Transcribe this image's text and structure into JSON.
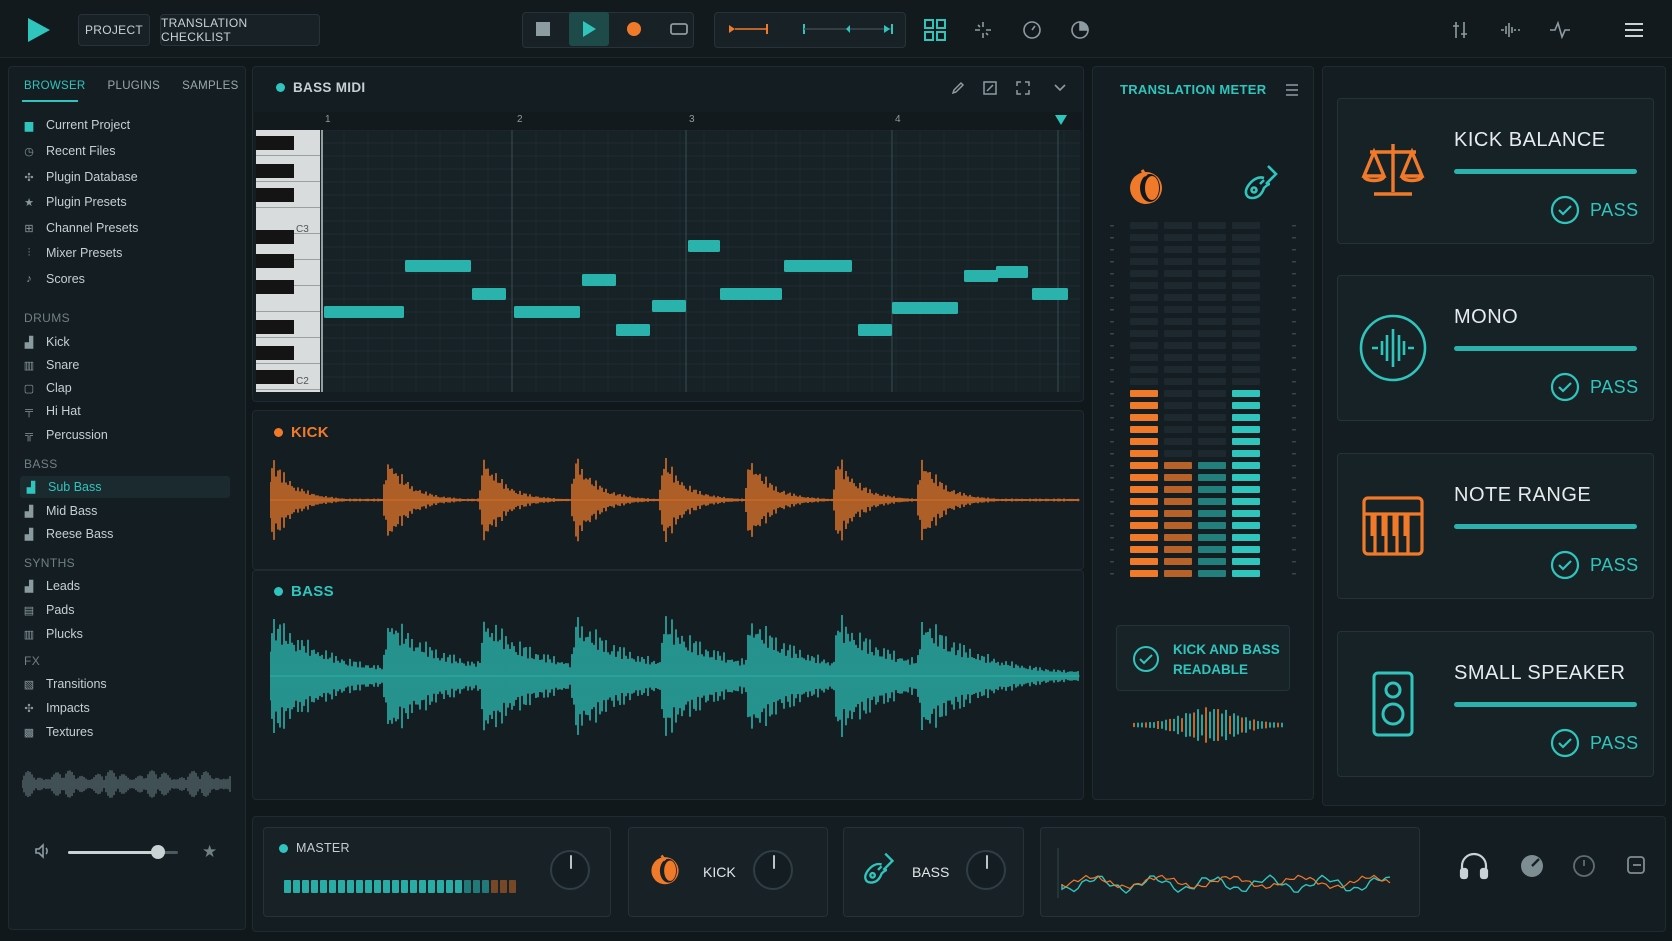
{
  "toolbar": {
    "project_label": "PROJECT",
    "checklist_label": "TRANSLATION CHECKLIST",
    "icons": [
      "play-logo-icon",
      "stop-icon",
      "play-icon",
      "record-icon",
      "loop-icon",
      "marker-icon",
      "timeline-icon",
      "grid-icon",
      "snap-icon",
      "metronome-icon",
      "tempo-icon",
      "tune-icon",
      "waveform-icon",
      "pulse-icon",
      "menu-icon"
    ]
  },
  "browser": {
    "tabs": [
      "BROWSER",
      "PLUGINS",
      "SAMPLES"
    ],
    "active_tab": "BROWSER",
    "items": [
      "Current Project",
      "Recent Files",
      "Plugin Database",
      "Plugin Presets",
      "Channel Presets",
      "Mixer Presets",
      "Scores"
    ],
    "drums_heading": "DRUMS",
    "drums": [
      "Kick",
      "Snare",
      "Clap",
      "Hi Hat",
      "Percussion"
    ],
    "bass_heading": "BASS",
    "bass": [
      "Sub Bass",
      "Mid Bass",
      "Reese Bass"
    ],
    "selected": "Sub Bass",
    "synths_heading": "SYNTHS",
    "synths": [
      "Leads",
      "Pads",
      "Plucks"
    ],
    "fx_heading": "FX",
    "fx": [
      "Transitions",
      "Impacts",
      "Textures"
    ],
    "volume": 0.82
  },
  "piano_roll": {
    "title": "BASS MIDI",
    "bars": [
      "1",
      "2",
      "3",
      "4"
    ],
    "keys": [
      "C3",
      "C2"
    ]
  },
  "tracks": {
    "kick_label": "KICK",
    "bass_label": "BASS"
  },
  "meter": {
    "title": "TRANSLATION METER",
    "status_line1": "KICK AND BASS",
    "status_line2": "READABLE"
  },
  "checks": [
    {
      "title": "KICK BALANCE",
      "status": "PASS",
      "icon": "scale-icon"
    },
    {
      "title": "MONO",
      "status": "PASS",
      "icon": "mono-wave-icon"
    },
    {
      "title": "NOTE RANGE",
      "status": "PASS",
      "icon": "keyboard-icon"
    },
    {
      "title": "SMALL SPEAKER",
      "status": "PASS",
      "icon": "speaker-icon"
    }
  ],
  "mixer": {
    "master_label": "MASTER",
    "kick_label": "KICK",
    "bass_label": "BASS"
  },
  "colors": {
    "accent": "#2fc5bd",
    "kick": "#f07a2a",
    "bg": "#10181c"
  }
}
